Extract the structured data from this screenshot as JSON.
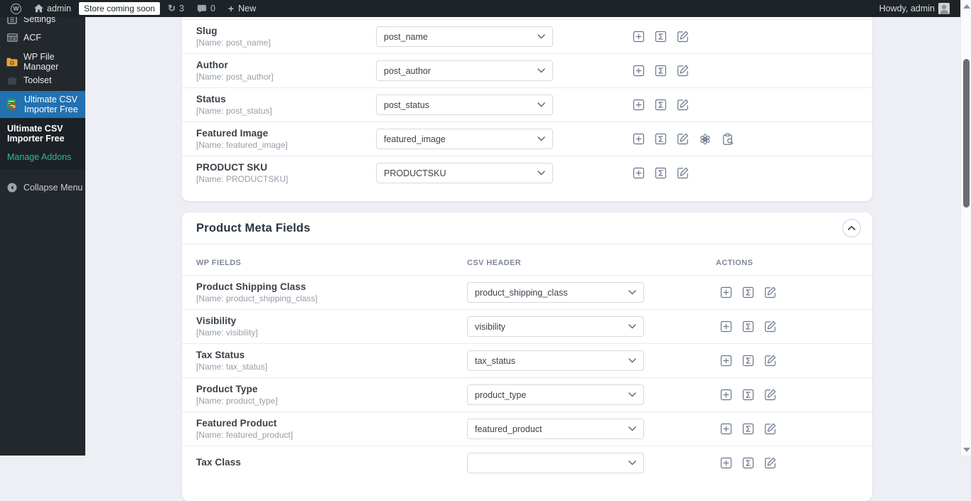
{
  "colors": {
    "admin_bar_bg": "#1d2327",
    "sidebar_bg": "#23282d",
    "active_menu_blue": "#2271b1",
    "submenu_link_teal": "#38b593",
    "page_bg": "#edeff4",
    "card_bg": "#ffffff",
    "action_icon_gray": "#68758a",
    "heading_navy": "#2b3445"
  },
  "admin_bar": {
    "wp_logo": "W",
    "site_name": "admin",
    "coming_soon_label": "Store coming soon",
    "updates_icon": "↻",
    "updates_count": "3",
    "comments_count": "0",
    "new_icon": "+",
    "new_label": "New",
    "howdy": "Howdy, admin"
  },
  "sidebar": {
    "items": [
      {
        "label": "Settings",
        "icon": "settings-icon"
      },
      {
        "label": "ACF",
        "icon": "acf-icon"
      },
      {
        "label": "WP File Manager",
        "icon": "folder-icon"
      },
      {
        "label": "Toolset",
        "icon": "toolset-icon"
      },
      {
        "label": "Ultimate CSV Importer Free",
        "icon": "csv-importer-icon",
        "active": true
      }
    ],
    "submenu": [
      {
        "label": "Ultimate CSV Importer Free",
        "active": true
      },
      {
        "label": "Manage Addons"
      }
    ],
    "collapse_label": "Collapse Menu"
  },
  "mapping_section": {
    "rows": [
      {
        "label": "Slug",
        "name": "[Name: post_name]",
        "value": "post_name"
      },
      {
        "label": "Author",
        "name": "[Name: post_author]",
        "value": "post_author"
      },
      {
        "label": "Status",
        "name": "[Name: post_status]",
        "value": "post_status"
      },
      {
        "label": "Featured Image",
        "name": "[Name: featured_image]",
        "value": "featured_image",
        "extra": true
      },
      {
        "label": "PRODUCT SKU",
        "name": "[Name: PRODUCTSKU]",
        "value": "PRODUCTSKU"
      }
    ]
  },
  "meta_section": {
    "title": "Product Meta Fields",
    "columns": [
      "WP Fields",
      "CSV Header",
      "Actions"
    ],
    "rows": [
      {
        "label": "Product Shipping Class",
        "name": "[Name: product_shipping_class]",
        "value": "product_shipping_class"
      },
      {
        "label": "Visibility",
        "name": "[Name: visibility]",
        "value": "visibility"
      },
      {
        "label": "Tax Status",
        "name": "[Name: tax_status]",
        "value": "tax_status"
      },
      {
        "label": "Product Type",
        "name": "[Name: product_type]",
        "value": "product_type"
      },
      {
        "label": "Featured Product",
        "name": "[Name: featured_product]",
        "value": "featured_product"
      },
      {
        "label": "Tax Class",
        "name": "",
        "value": ""
      }
    ]
  },
  "icons": {
    "actions": [
      "add-icon",
      "sigma-icon",
      "edit-icon"
    ],
    "featured_image_extra": [
      "openai-icon",
      "media-search-icon"
    ]
  }
}
